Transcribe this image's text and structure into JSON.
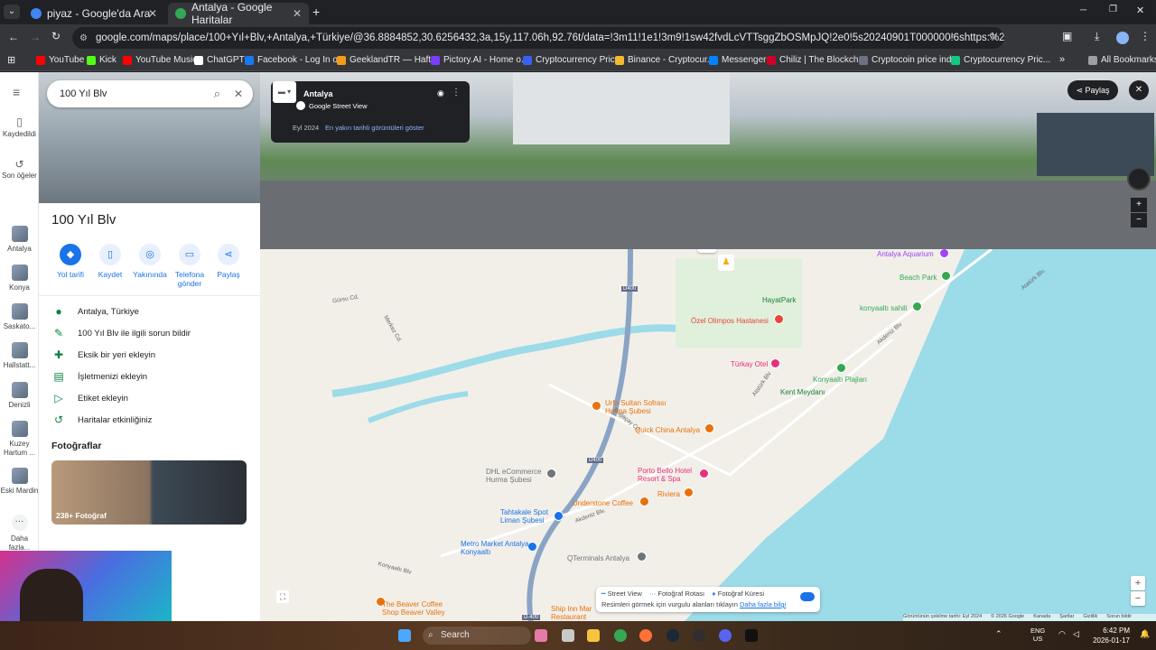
{
  "browser": {
    "tabs": [
      {
        "title": "piyaz - Google'da Ara",
        "favicon_color": "#4285f4"
      },
      {
        "title": "Antalya - Google Haritalar",
        "favicon_color": "#34a853"
      }
    ],
    "new_tab_label": "+",
    "url": "google.com/maps/place/100+Yıl+Blv,+Antalya,+Türkiye/@36.8884852,30.6256432,3a,15y,117.06h,92.76t/data=!3m11!1e1!3m9!1sw42fvdLcVTTsggZbOSMpJQ!2e0!5s20240901T000000!6shttps:%2F%2Fstreetviewpixels-pa.googl...",
    "bookmarks": [
      {
        "label": "YouTube",
        "color": "#ff0000"
      },
      {
        "label": "Kick",
        "color": "#53fc18"
      },
      {
        "label": "YouTube Music",
        "color": "#ff0000"
      },
      {
        "label": "ChatGPT",
        "color": "#ffffff"
      },
      {
        "label": "Facebook - Log In o...",
        "color": "#1877f2"
      },
      {
        "label": "GeeklandTR — Haft...",
        "color": "#f59c1a"
      },
      {
        "label": "Pictory.AI - Home o...",
        "color": "#7a3cff"
      },
      {
        "label": "Cryptocurrency Pric...",
        "color": "#3861fb"
      },
      {
        "label": "Binance - Cryptocur...",
        "color": "#f3ba2f"
      },
      {
        "label": "Messenger",
        "color": "#0084ff"
      },
      {
        "label": "Chiliz | The Blockch...",
        "color": "#cd0124"
      },
      {
        "label": "Cryptocoin price ind...",
        "color": "#6b7280"
      },
      {
        "label": "Cryptocurrency Pric...",
        "color": "#16c784"
      }
    ],
    "all_bookmarks": "All Bookmarks"
  },
  "rail": {
    "menu": "≡",
    "items": [
      {
        "label": "Kaydedildi",
        "icon": "bookmark-icon"
      },
      {
        "label": "Son öğeler",
        "icon": "history-icon"
      },
      {
        "label": "Antalya",
        "icon": "recent-thumb"
      },
      {
        "label": "Konya",
        "icon": "recent-thumb"
      },
      {
        "label": "Saskato...",
        "icon": "recent-thumb"
      },
      {
        "label": "Hallstatt...",
        "icon": "recent-thumb"
      },
      {
        "label": "Denizli",
        "icon": "recent-thumb"
      },
      {
        "label": "Kuzey Hartum ...",
        "icon": "recent-thumb"
      },
      {
        "label": "Eski Mardin",
        "icon": "recent-thumb"
      },
      {
        "label": "Daha fazla...",
        "icon": "more-icon"
      }
    ]
  },
  "panel": {
    "search_value": "100 Yıl Blv",
    "title": "100 Yıl Blv",
    "actions": [
      {
        "label": "Yol tarifi",
        "icon": "◆"
      },
      {
        "label": "Kaydet",
        "icon": "▯"
      },
      {
        "label": "Yakınında",
        "icon": "◎"
      },
      {
        "label": "Telefona gönder",
        "icon": "▭"
      },
      {
        "label": "Paylaş",
        "icon": "⋖"
      }
    ],
    "info": [
      {
        "label": "Antalya, Türkiye",
        "icon": "●"
      },
      {
        "label": "100 Yıl Blv ile ilgili sorun bildir",
        "icon": "✎"
      },
      {
        "label": "Eksik bir yeri ekleyin",
        "icon": "✚"
      },
      {
        "label": "İşletmenizi ekleyin",
        "icon": "▤"
      },
      {
        "label": "Etiket ekleyin",
        "icon": "▷"
      },
      {
        "label": "Haritalar etkinliğiniz",
        "icon": "↺"
      }
    ],
    "photos_heading": "Fotoğraflar",
    "photos_count": "238+ Fotoğraf"
  },
  "streetview": {
    "place": "Antalya",
    "source": "Google Street View",
    "date": "Eyl 2024",
    "date_link": "En yakın tarihli görüntüleri göster",
    "share": "Paylaş"
  },
  "map": {
    "road_labels": [
      {
        "text": "D400"
      },
      {
        "text": "D400"
      },
      {
        "text": "D-400"
      }
    ],
    "places": [
      {
        "text": "Antalya Aquarium",
        "color": "#a142f4"
      },
      {
        "text": "Beach Park",
        "color": "#34a853"
      },
      {
        "text": "HayatPark",
        "color": "#188038"
      },
      {
        "text": "konyaaltı sahili",
        "color": "#34a853"
      },
      {
        "text": "Özel Olimpos Hastanesi",
        "color": "#e8453c"
      },
      {
        "text": "Türkay Otel",
        "color": "#e8307a"
      },
      {
        "text": "Konyaaltı Plajları",
        "color": "#34a853"
      },
      {
        "text": "Kent Meydanı",
        "color": "#188038"
      },
      {
        "text": "Urfa Sultan Sofrası Hurma Şubesi",
        "color": "#e8710a"
      },
      {
        "text": "Quick China Antalya",
        "color": "#e8710a"
      },
      {
        "text": "DHL eCommerce Hurma Şubesi",
        "color": "#70757a"
      },
      {
        "text": "Porto Bello Hotel Resort & Spa",
        "color": "#e8307a"
      },
      {
        "text": "Riviera",
        "color": "#e8710a"
      },
      {
        "text": "Understone Coffee",
        "color": "#e8710a"
      },
      {
        "text": "Tahtakale Spot Liman Şubesi",
        "color": "#1a73e8"
      },
      {
        "text": "Metro Market Antalya - Konyaaltı",
        "color": "#1a73e8"
      },
      {
        "text": "QTerminals Antalya",
        "color": "#70757a"
      },
      {
        "text": "The Beaver Coffee Shop Beaver Valley",
        "color": "#e8710a"
      },
      {
        "text": "Ship Inn Mar Restaurant",
        "color": "#e8710a"
      }
    ],
    "streets": [
      "Akdeniz Blv",
      "Atatürk Blv",
      "Boğaçay Cd.",
      "Gürsu Cd.",
      "Merkez Cd.",
      "Konyaaltı Blv",
      "Akdeniz Blv.",
      "Atatürk Blv."
    ],
    "legend": {
      "street_view": "Street View",
      "photo_route": "Fotoğraf Rotası",
      "photo_sphere": "Fotoğraf Küresi",
      "hint": "Resimleri görmek için vurgulu alanları tıklayın",
      "hint_link": "Daha fazla bilgi"
    },
    "footer": [
      "Görüntünün çekilme tarihi: Eyl 2024",
      "© 2026 Google",
      "Kanada",
      "Şartlar",
      "Gizlilik",
      "Sorun bildir"
    ]
  },
  "taskbar": {
    "search_placeholder": "Search",
    "lang": "ENG",
    "region": "US",
    "time": "6:42 PM",
    "date": "2026-01-17"
  }
}
